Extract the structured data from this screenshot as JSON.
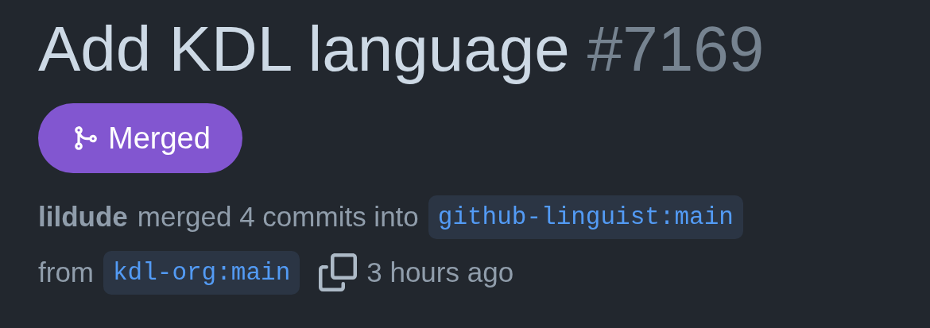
{
  "title": "Add KDL language",
  "number": "#7169",
  "state": {
    "kind": "merged",
    "label": "Merged"
  },
  "meta": {
    "author": "lildude",
    "action": "merged 4 commits into",
    "base_branch": "github-linguist:main",
    "from_label": "from",
    "head_branch": "kdl-org:main",
    "time": "3 hours ago"
  }
}
